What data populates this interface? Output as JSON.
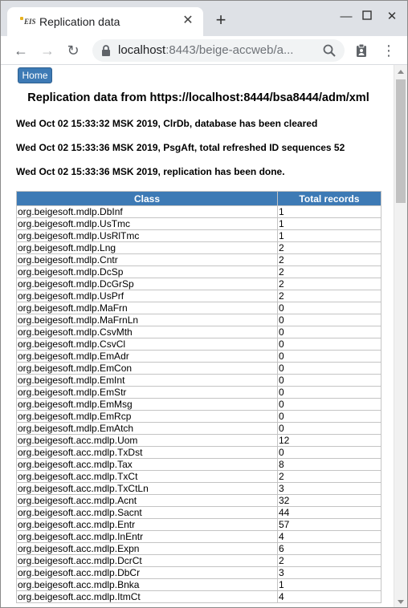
{
  "tab": {
    "favicon_text": "EIS",
    "title": "Replication data",
    "close_glyph": "✕",
    "newtab_glyph": "+"
  },
  "window_controls": {
    "minimize": "—",
    "maximize": "☐",
    "close": "✕"
  },
  "toolbar": {
    "back": "←",
    "forward": "→",
    "reload": "↻",
    "menu": "⋮"
  },
  "address": {
    "host": "localhost",
    "rest": ":8443/beige-accweb/a..."
  },
  "page": {
    "home_button": "Home",
    "title": "Replication data from https://localhost:8444/bsa8444/adm/xml",
    "log": [
      "Wed Oct 02 15:33:32 MSK 2019, ClrDb, database has been cleared",
      "Wed Oct 02 15:33:36 MSK 2019, PsgAft, total refreshed ID sequences 52",
      "Wed Oct 02 15:33:36 MSK 2019, replication has been done."
    ]
  },
  "table": {
    "headers": [
      "Class",
      "Total records"
    ],
    "rows": [
      [
        "org.beigesoft.mdlp.DbInf",
        "1"
      ],
      [
        "org.beigesoft.mdlp.UsTmc",
        "1"
      ],
      [
        "org.beigesoft.mdlp.UsRlTmc",
        "1"
      ],
      [
        "org.beigesoft.mdlp.Lng",
        "2"
      ],
      [
        "org.beigesoft.mdlp.Cntr",
        "2"
      ],
      [
        "org.beigesoft.mdlp.DcSp",
        "2"
      ],
      [
        "org.beigesoft.mdlp.DcGrSp",
        "2"
      ],
      [
        "org.beigesoft.mdlp.UsPrf",
        "2"
      ],
      [
        "org.beigesoft.mdlp.MaFrn",
        "0"
      ],
      [
        "org.beigesoft.mdlp.MaFrnLn",
        "0"
      ],
      [
        "org.beigesoft.mdlp.CsvMth",
        "0"
      ],
      [
        "org.beigesoft.mdlp.CsvCl",
        "0"
      ],
      [
        "org.beigesoft.mdlp.EmAdr",
        "0"
      ],
      [
        "org.beigesoft.mdlp.EmCon",
        "0"
      ],
      [
        "org.beigesoft.mdlp.EmInt",
        "0"
      ],
      [
        "org.beigesoft.mdlp.EmStr",
        "0"
      ],
      [
        "org.beigesoft.mdlp.EmMsg",
        "0"
      ],
      [
        "org.beigesoft.mdlp.EmRcp",
        "0"
      ],
      [
        "org.beigesoft.mdlp.EmAtch",
        "0"
      ],
      [
        "org.beigesoft.acc.mdlp.Uom",
        "12"
      ],
      [
        "org.beigesoft.acc.mdlp.TxDst",
        "0"
      ],
      [
        "org.beigesoft.acc.mdlp.Tax",
        "8"
      ],
      [
        "org.beigesoft.acc.mdlp.TxCt",
        "2"
      ],
      [
        "org.beigesoft.acc.mdlp.TxCtLn",
        "3"
      ],
      [
        "org.beigesoft.acc.mdlp.Acnt",
        "32"
      ],
      [
        "org.beigesoft.acc.mdlp.Sacnt",
        "44"
      ],
      [
        "org.beigesoft.acc.mdlp.Entr",
        "57"
      ],
      [
        "org.beigesoft.acc.mdlp.InEntr",
        "4"
      ],
      [
        "org.beigesoft.acc.mdlp.Expn",
        "6"
      ],
      [
        "org.beigesoft.acc.mdlp.DcrCt",
        "2"
      ],
      [
        "org.beigesoft.acc.mdlp.DbCr",
        "3"
      ],
      [
        "org.beigesoft.acc.mdlp.Bnka",
        "1"
      ],
      [
        "org.beigesoft.acc.mdlp.ItmCt",
        "4"
      ]
    ]
  },
  "colors": {
    "header_bg": "#3d7ab5",
    "tabstrip_bg": "#dee1e6"
  }
}
